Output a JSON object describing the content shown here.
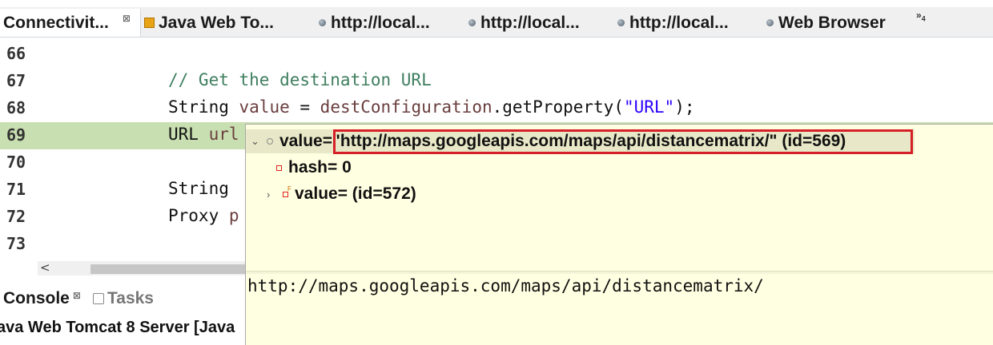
{
  "tabs": [
    {
      "label": "Connectivit...",
      "icon": "",
      "active": true,
      "close": "⊠"
    },
    {
      "label": "Java Web To...",
      "icon": "server-icon",
      "active": false
    },
    {
      "label": "http://local...",
      "icon": "browser-dot-icon",
      "active": false
    },
    {
      "label": "http://local...",
      "icon": "browser-dot-icon",
      "active": false
    },
    {
      "label": "http://local...",
      "icon": "browser-dot-icon",
      "active": false
    },
    {
      "label": "Web Browser",
      "icon": "browser-dot-icon",
      "active": false
    }
  ],
  "tab_overflow": {
    "symbol": "»",
    "count": "4"
  },
  "editor": {
    "lines": [
      {
        "num": "66"
      },
      {
        "num": "67",
        "comment": "// Get the destination URL"
      },
      {
        "num": "68",
        "kw": "String ",
        "var": "value",
        "mid": " = ",
        "var2": "destConfiguration",
        "call": ".getProperty(",
        "str": "\"URL\"",
        "end": ");"
      },
      {
        "num": "69",
        "kw": "URL ",
        "var": "url",
        "current": true
      },
      {
        "num": "70"
      },
      {
        "num": "71",
        "kw": "String"
      },
      {
        "num": "72",
        "kw": "Proxy ",
        "var": "p"
      },
      {
        "num": "73"
      }
    ],
    "scroll_left_arrow": "<"
  },
  "console": {
    "tabs": [
      {
        "label": "Console",
        "close": "⊠",
        "icon": ""
      },
      {
        "label": "Tasks",
        "icon": "tasks-icon"
      }
    ],
    "header": "ava Web Tomcat 8 Server [Java"
  },
  "popup": {
    "rows": [
      {
        "twisty": "⌄",
        "icon": "field-icon",
        "label": "value= ",
        "value": "\"http://maps.googleapis.com/maps/api/distancematrix/\" (id=569)"
      },
      {
        "twisty": "",
        "icon": "private-field-icon",
        "label": "hash= 0"
      },
      {
        "twisty": "›",
        "icon": "final-field-icon",
        "label": "value= (id=572)"
      }
    ],
    "detail": "http://maps.googleapis.com/maps/api/distancematrix/"
  },
  "colors": {
    "current_line": "#c8dfb1",
    "popup_bg": "#ffffe1",
    "highlight_border": "#d61f26",
    "comment": "#3f7f5f",
    "string": "#2a00ff",
    "variable": "#6a3e3e"
  }
}
